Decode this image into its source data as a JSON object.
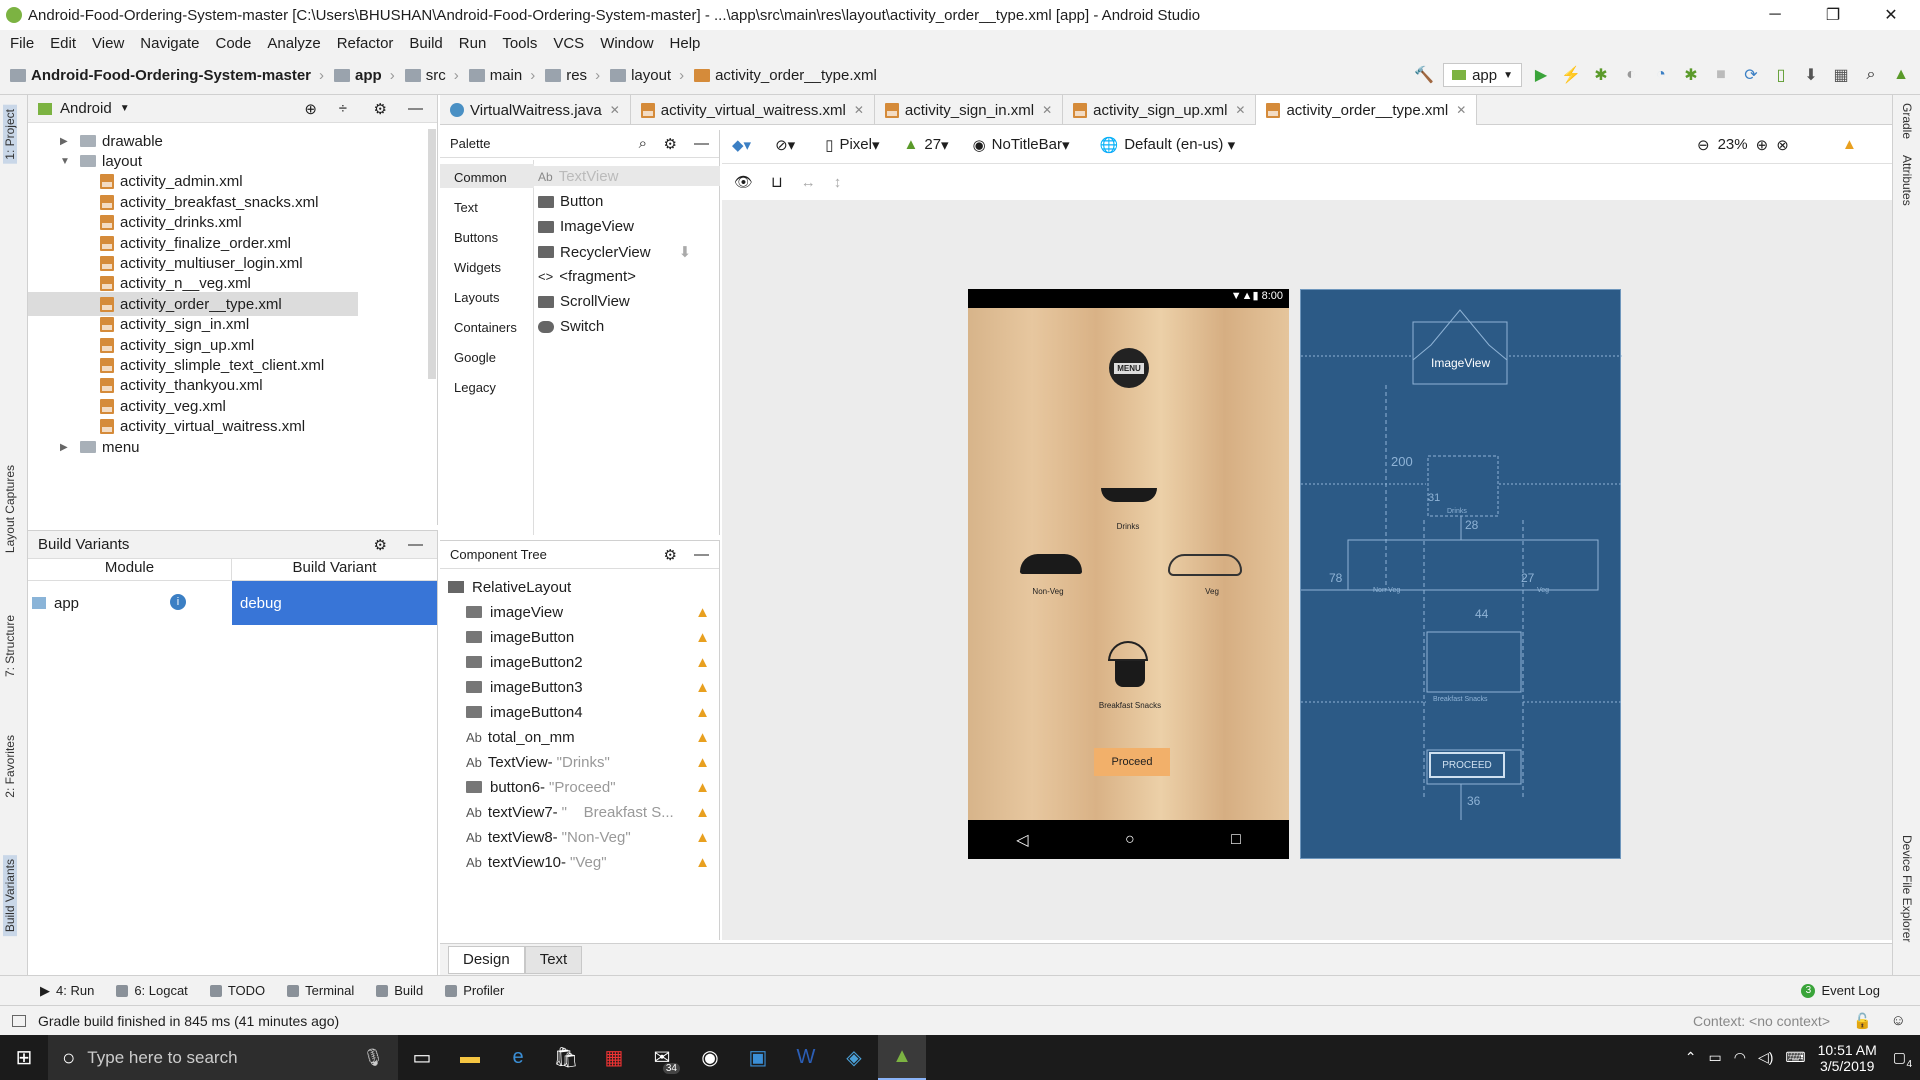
{
  "window": {
    "title": "Android-Food-Ordering-System-master [C:\\Users\\BHUSHAN\\Android-Food-Ordering-System-master] - ...\\app\\src\\main\\res\\layout\\activity_order__type.xml [app] - Android Studio",
    "minimize": "─",
    "maximize": "❐",
    "close": "✕"
  },
  "menu": [
    "File",
    "Edit",
    "View",
    "Navigate",
    "Code",
    "Analyze",
    "Refactor",
    "Build",
    "Run",
    "Tools",
    "VCS",
    "Window",
    "Help"
  ],
  "breadcrumb": [
    "Android-Food-Ordering-System-master",
    "app",
    "src",
    "main",
    "res",
    "layout",
    "activity_order__type.xml"
  ],
  "toolbar": {
    "run_config": "app"
  },
  "project": {
    "view_label": "Android",
    "tree": [
      {
        "label": "drawable",
        "type": "folder",
        "expanded": false,
        "indent": 1
      },
      {
        "label": "layout",
        "type": "folder",
        "expanded": true,
        "indent": 1
      },
      {
        "label": "activity_admin.xml",
        "type": "xml",
        "indent": 2
      },
      {
        "label": "activity_breakfast_snacks.xml",
        "type": "xml",
        "indent": 2
      },
      {
        "label": "activity_drinks.xml",
        "type": "xml",
        "indent": 2
      },
      {
        "label": "activity_finalize_order.xml",
        "type": "xml",
        "indent": 2
      },
      {
        "label": "activity_multiuser_login.xml",
        "type": "xml",
        "indent": 2
      },
      {
        "label": "activity_n__veg.xml",
        "type": "xml",
        "indent": 2
      },
      {
        "label": "activity_order__type.xml",
        "type": "xml",
        "indent": 2,
        "selected": true
      },
      {
        "label": "activity_sign_in.xml",
        "type": "xml",
        "indent": 2
      },
      {
        "label": "activity_sign_up.xml",
        "type": "xml",
        "indent": 2
      },
      {
        "label": "activity_slimple_text_client.xml",
        "type": "xml",
        "indent": 2
      },
      {
        "label": "activity_thankyou.xml",
        "type": "xml",
        "indent": 2
      },
      {
        "label": "activity_veg.xml",
        "type": "xml",
        "indent": 2
      },
      {
        "label": "activity_virtual_waitress.xml",
        "type": "xml",
        "indent": 2
      },
      {
        "label": "menu",
        "type": "folder",
        "expanded": false,
        "indent": 1
      }
    ]
  },
  "build_variants": {
    "title": "Build Variants",
    "col_module": "Module",
    "col_variant": "Build Variant",
    "module": "app",
    "variant": "debug"
  },
  "editor_tabs": [
    {
      "label": "VirtualWaitress.java",
      "active": false
    },
    {
      "label": "activity_virtual_waitress.xml",
      "active": false
    },
    {
      "label": "activity_sign_in.xml",
      "active": false
    },
    {
      "label": "activity_sign_up.xml",
      "active": false
    },
    {
      "label": "activity_order__type.xml",
      "active": true
    }
  ],
  "palette": {
    "title": "Palette",
    "categories": [
      "Common",
      "Text",
      "Buttons",
      "Widgets",
      "Layouts",
      "Containers",
      "Google",
      "Legacy"
    ],
    "items": [
      "TextView",
      "Button",
      "ImageView",
      "RecyclerView",
      "<fragment>",
      "ScrollView",
      "Switch"
    ]
  },
  "component_tree": {
    "title": "Component Tree",
    "root": "RelativeLayout",
    "items": [
      {
        "name": "imageView",
        "detail": ""
      },
      {
        "name": "imageButton",
        "detail": ""
      },
      {
        "name": "imageButton2",
        "detail": ""
      },
      {
        "name": "imageButton3",
        "detail": ""
      },
      {
        "name": "imageButton4",
        "detail": ""
      },
      {
        "name": "total_on_mm",
        "detail": ""
      },
      {
        "name": "TextView-",
        "detail": "\"Drinks\""
      },
      {
        "name": "button6-",
        "detail": "\"Proceed\""
      },
      {
        "name": "textView7-",
        "detail": "\"    Breakfast S..."
      },
      {
        "name": "textView8-",
        "detail": "\"Non-Veg\""
      },
      {
        "name": "textView10-",
        "detail": "\"Veg\""
      }
    ]
  },
  "design_toolbar": {
    "device": "Pixel",
    "api": "27",
    "theme": "NoTitleBar",
    "locale": "Default (en-us)",
    "zoom": "23%"
  },
  "preview": {
    "status_time": "8:00",
    "menu_label": "MENU",
    "drinks": "Drinks",
    "nonveg": "Non-Veg",
    "veg": "Veg",
    "breakfast": "Breakfast Snacks",
    "proceed": "Proceed"
  },
  "blueprint": {
    "imageview": "ImageView",
    "proceed": "PROCEED",
    "m200": "200",
    "m31": "31",
    "m28": "28",
    "m78": "78",
    "m27": "27",
    "m44": "44",
    "m36": "36",
    "drinks": "Drinks",
    "nonveg": "Non-Veg",
    "veg": "Veg",
    "breakfast": "Breakfast Snacks"
  },
  "bottom_tabs": [
    "Design",
    "Text"
  ],
  "tool_windows": [
    "4: Run",
    "6: Logcat",
    "TODO",
    "Terminal",
    "Build",
    "Profiler"
  ],
  "event_log": {
    "count": "3",
    "label": "Event Log"
  },
  "status": {
    "message": "Gradle build finished in 845 ms (41 minutes ago)",
    "context": "Context: <no context>"
  },
  "side_tabs_left": [
    "1: Project",
    "Layout Captures",
    "7: Structure",
    "2: Favorites",
    "Build Variants"
  ],
  "side_tabs_right": [
    "Gradle",
    "Attributes",
    "Device File Explorer"
  ],
  "taskbar": {
    "search_placeholder": "Type here to search",
    "time": "10:51 AM",
    "date": "3/5/2019",
    "mail_badge": "34",
    "notif_count": "4"
  },
  "colors": {
    "accent_blue": "#3875d7",
    "warning": "#e8a020",
    "blueprint": "#2c5a86",
    "proceed": "#f2b06a"
  }
}
